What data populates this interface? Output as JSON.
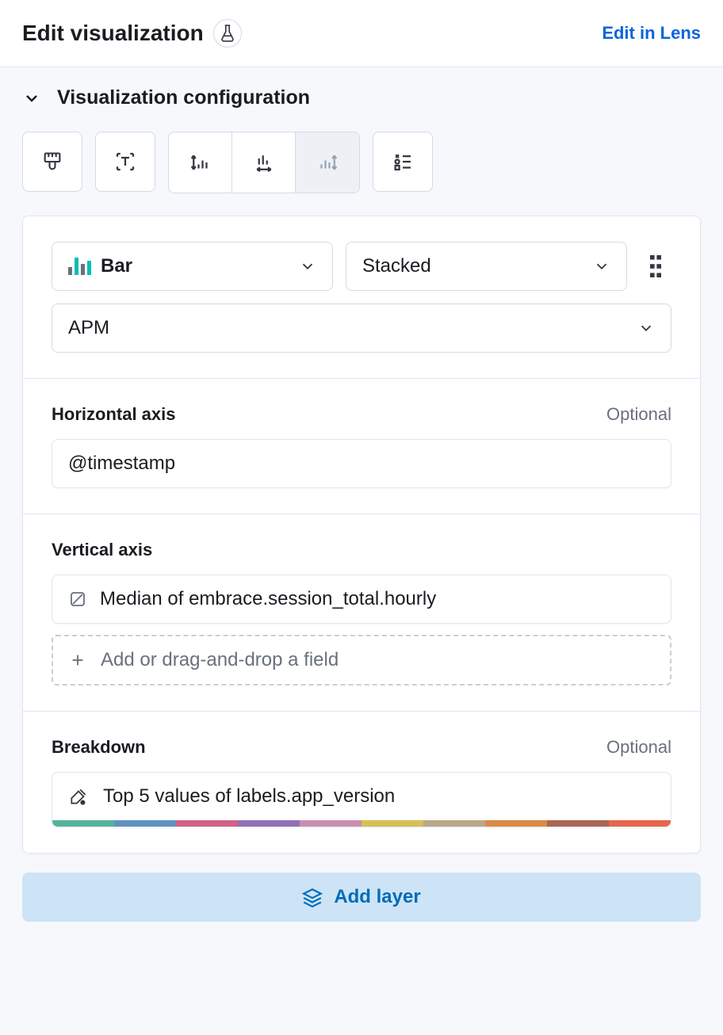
{
  "header": {
    "title": "Edit visualization",
    "link": "Edit in Lens"
  },
  "section": {
    "title": "Visualization configuration"
  },
  "config": {
    "chart_type_label": "Bar",
    "stacking_label": "Stacked",
    "index_pattern_label": "APM"
  },
  "horizontal_axis": {
    "label": "Horizontal axis",
    "optional": "Optional",
    "field": "@timestamp"
  },
  "vertical_axis": {
    "label": "Vertical axis",
    "field": "Median of embrace.session_total.hourly",
    "add_placeholder": "Add or drag-and-drop a field"
  },
  "breakdown": {
    "label": "Breakdown",
    "optional": "Optional",
    "field": "Top 5 values of labels.app_version",
    "palette": [
      "#54b399",
      "#6092c0",
      "#d36086",
      "#9170b8",
      "#ca8eae",
      "#d6bf57",
      "#b9a888",
      "#da8b45",
      "#aa6556",
      "#e7664c"
    ]
  },
  "add_layer_label": "Add layer"
}
